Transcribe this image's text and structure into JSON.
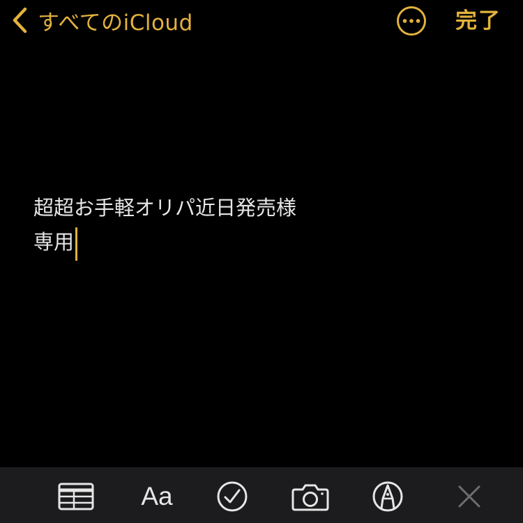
{
  "nav": {
    "back_label": "すべてのiCloud",
    "done_label": "完了",
    "more_icon": "ellipsis-circle-icon",
    "back_icon": "chevron-left-icon"
  },
  "note": {
    "lines": [
      "超超お手軽オリパ近日発売様",
      "専用"
    ]
  },
  "toolbar": {
    "items": [
      {
        "name": "table-button",
        "icon": "table-icon"
      },
      {
        "name": "format-button",
        "label": "Aa",
        "icon": "text-format-icon"
      },
      {
        "name": "checklist-button",
        "icon": "checkmark-circle-icon"
      },
      {
        "name": "camera-button",
        "icon": "camera-icon"
      },
      {
        "name": "markup-button",
        "icon": "pen-tip-circle-icon"
      },
      {
        "name": "close-button",
        "icon": "close-icon"
      }
    ]
  },
  "colors": {
    "accent": "#E3B23C",
    "background": "#000000",
    "toolbar_background": "#1C1C1E",
    "text": "#E6E6E6",
    "disabled": "#6E6E72"
  }
}
